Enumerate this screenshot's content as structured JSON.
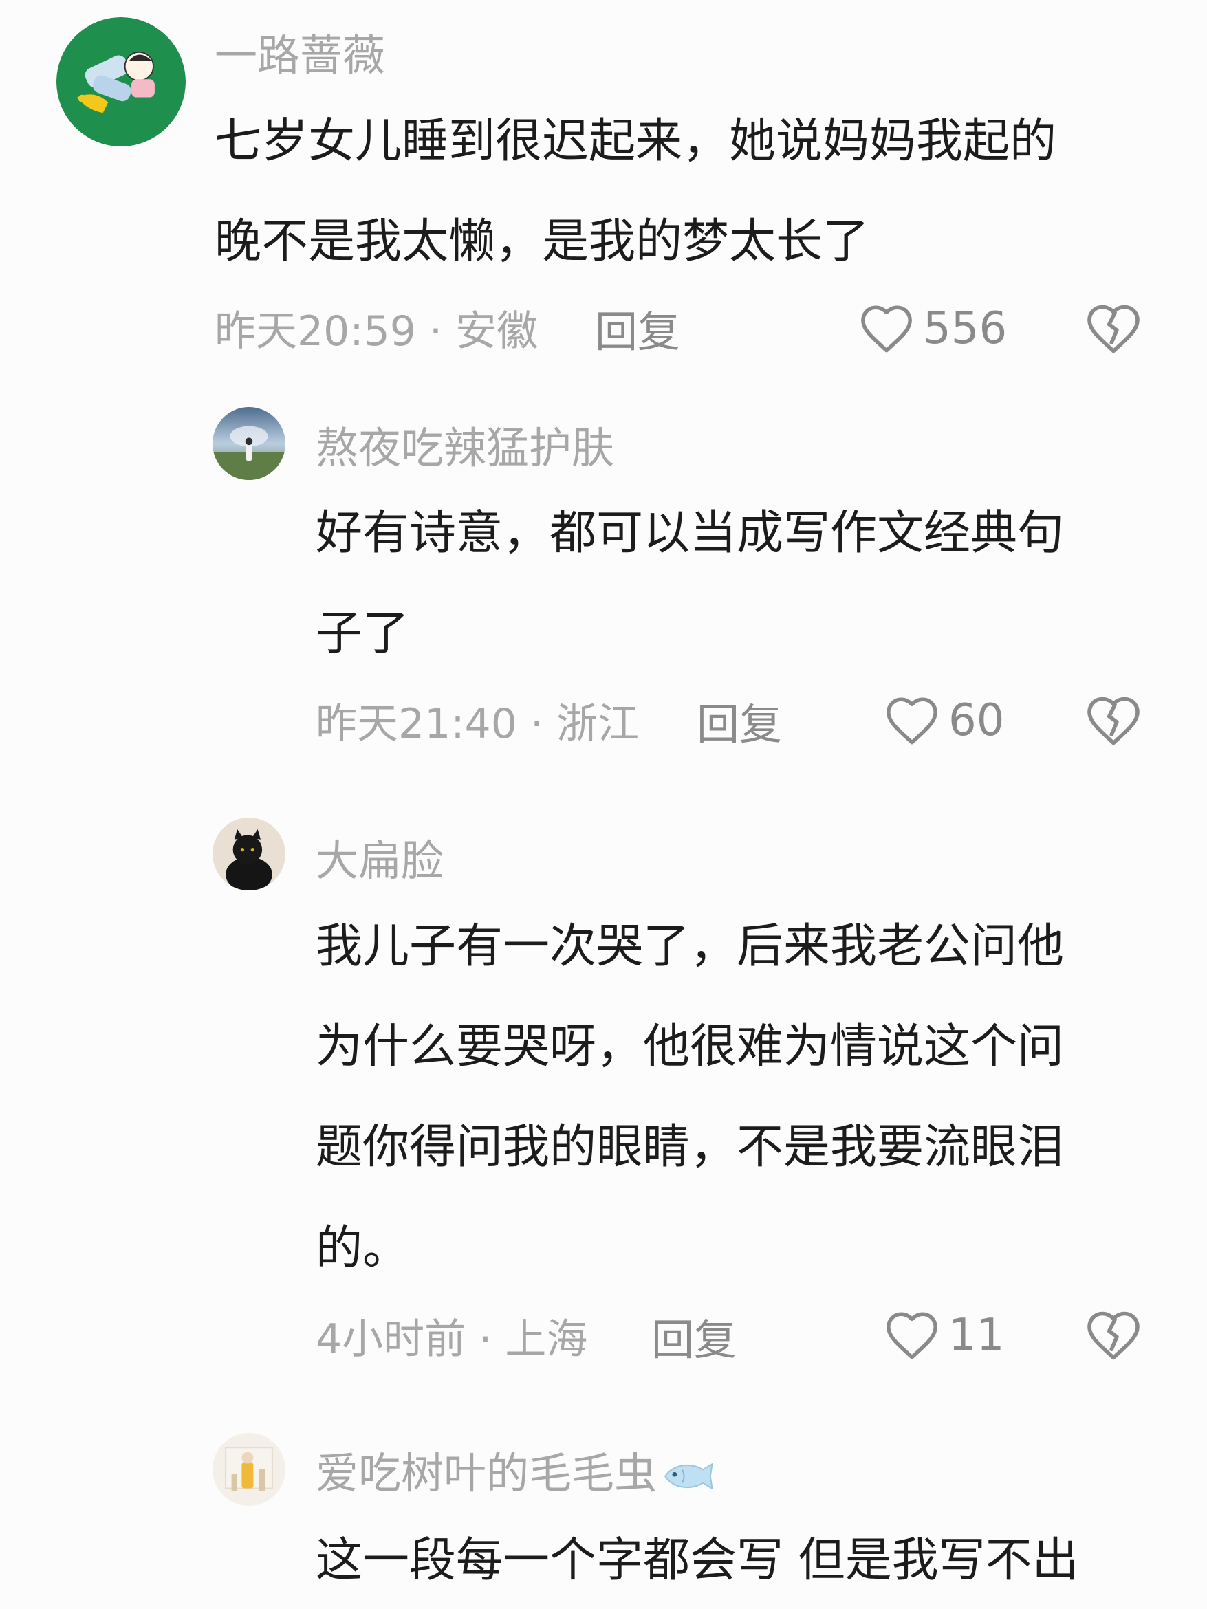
{
  "comments": [
    {
      "username": "一路蔷薇",
      "lines": [
        "七岁女儿睡到很迟起来，她说妈妈我起的",
        "晚不是我太懒，是我的梦太长了"
      ],
      "meta": "昨天20:59 · 安徽",
      "reply_label": "回复",
      "likes": "556"
    },
    {
      "username": "熬夜吃辣猛护肤",
      "lines": [
        "好有诗意，都可以当成写作文经典句",
        "子了"
      ],
      "meta": "昨天21:40 · 浙江",
      "reply_label": "回复",
      "likes": "60"
    },
    {
      "username": "大扁脸",
      "lines": [
        "我儿子有一次哭了，后来我老公问他",
        "为什么要哭呀，他很难为情说这个问",
        "题你得问我的眼睛，不是我要流眼泪",
        "的。"
      ],
      "meta": "4小时前 · 上海",
      "reply_label": "回复",
      "likes": "11"
    },
    {
      "username": "爱吃树叶的毛毛虫",
      "lines": [
        "这一段每一个字都会写 但是我写不出"
      ]
    }
  ],
  "colors": {
    "background": "#fcfcfc",
    "text": "#1c1c1c",
    "secondary": "#a7a7a7",
    "icon": "#8a8a8a",
    "avatar_green": "#1f8f4e"
  },
  "icons": [
    "heart-outline-icon",
    "broken-heart-icon",
    "fish-emoji-icon"
  ]
}
